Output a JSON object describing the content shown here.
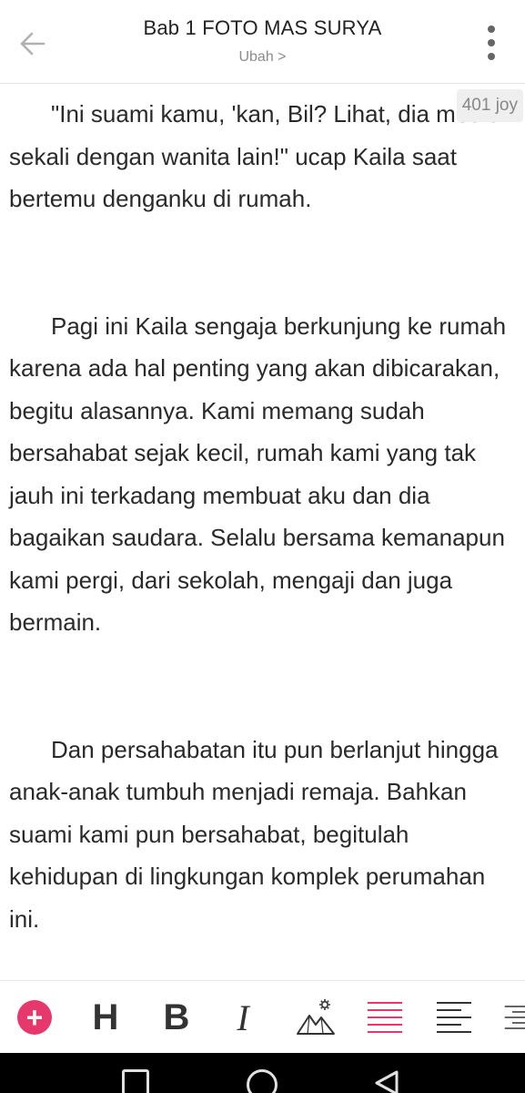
{
  "header": {
    "title": "Bab 1 FOTO MAS SURYA",
    "subtitle": "Ubah >"
  },
  "word_badge": "401 joy",
  "content": {
    "paragraphs": [
      "\"Ini suami kamu, 'kan, Bil? Lihat, dia mesra sekali dengan wanita lain!\" ucap Kaila saat bertemu denganku di rumah.",
      "Pagi ini Kaila sengaja berkunjung ke rumah karena ada hal penting yang akan dibicarakan, begitu alasannya. Kami memang sudah bersahabat sejak kecil, rumah kami yang tak jauh ini terkadang membuat aku dan dia bagaikan saudara. Selalu bersama kemanapun kami pergi, dari sekolah, mengaji dan juga bermain.",
      "Dan persahabatan itu pun berlanjut hingga anak-anak tumbuh menjadi remaja. Bahkan suami kami pun bersahabat, begitulah kehidupan di lingkungan komplek perumahan ini."
    ]
  },
  "toolbar": {
    "add_symbol": "+",
    "heading_label": "H",
    "bold_label": "B",
    "italic_label": "I"
  },
  "colors": {
    "accent": "#e6386d",
    "icon": "#333333",
    "muted": "#8c8c8c"
  }
}
